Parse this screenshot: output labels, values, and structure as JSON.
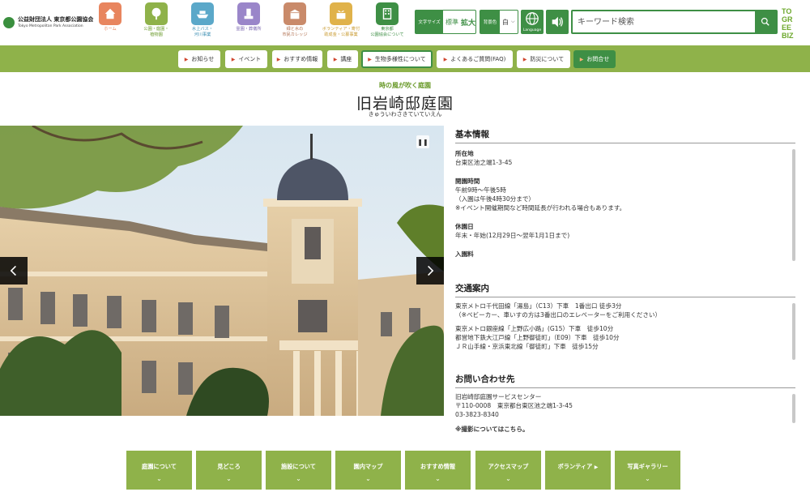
{
  "header": {
    "logo": {
      "line1": "公益財団法人 東京都公園協会",
      "line2": "Tokyo Metropolitan Park Association"
    },
    "nav_icons": [
      {
        "label": "ホーム",
        "color": "#e8855e",
        "icon": "home-icon"
      },
      {
        "label": "公園・庭園・\n植物園",
        "color": "#8fb24a",
        "icon": "tree-icon"
      },
      {
        "label": "水上バス・\n河川事業",
        "color": "#5ba8c9",
        "icon": "boat-icon"
      },
      {
        "label": "霊園・葬儀所",
        "color": "#9a86c9",
        "icon": "memorial-icon"
      },
      {
        "label": "緑と水の\n市民カレッジ",
        "color": "#c98a6a",
        "icon": "college-icon"
      },
      {
        "label": "ボランティア・寄付\n助成金・公募事業",
        "color": "#e0b24a",
        "icon": "volunteer-icon"
      },
      {
        "label": "東京都\n公園協会について",
        "color": "#3e8f45",
        "icon": "building-icon"
      }
    ],
    "font_size": {
      "title": "文字サイズ",
      "standard": "標準",
      "large": "拡大"
    },
    "bg_color": {
      "title": "背景色",
      "value": "白"
    },
    "language_label": "Language",
    "search": {
      "placeholder": "キーワード検索"
    },
    "brand": "TOKYO GREEN BIZ"
  },
  "gnav": {
    "items": [
      "お知らせ",
      "イベント",
      "おすすめ情報",
      "講座",
      "生物多様性について",
      "よくあるご質問(FAQ)",
      "防災について",
      "お問合せ"
    ]
  },
  "page": {
    "subtitle": "時の風が吹く庭園",
    "title": "旧岩崎邸庭園",
    "kana": "きゅういわさきていていえん"
  },
  "info": {
    "basic": {
      "heading": "基本情報",
      "address_label": "所在地",
      "address": "台東区池之端1-3-45",
      "hours_label": "開園時間",
      "hours": [
        "午前9時～午後5時",
        "（入園は午後4時30分まで）",
        "※イベント開催期間など時間延長が行われる場合もあります。"
      ],
      "closed_label": "休園日",
      "closed": "年末・年始(12月29日～翌年1月1日まで)",
      "fee_label": "入園料"
    },
    "access": {
      "heading": "交通案内",
      "lines": [
        "東京メトロ千代田線「湯島」（C13）下車　1番出口 徒歩3分",
        "（※ベビーカー、車いすの方は3番出口のエレベーターをご利用ください）",
        "",
        "東京メトロ銀座線「上野広小路」(G15）下車　徒歩10分",
        "都営地下鉄大江戸線「上野御徒町」（E09）下車　徒歩10分",
        "ＪＲ山手線・京浜東北線「御徒町」下車　徒歩15分"
      ]
    },
    "contact": {
      "heading": "お問い合わせ先",
      "lines": [
        "旧岩崎邸庭園サービスセンター",
        "〒110-0008　東京都台東区池之端1-3-45",
        "03-3823-8340"
      ],
      "photo_note": "※撮影についてはこちら。"
    }
  },
  "footer_nav": {
    "items": [
      "庭園について",
      "見どころ",
      "施設について",
      "園内マップ",
      "おすすめ情報",
      "アクセスマップ",
      "ボランティア",
      "写真ギャラリー"
    ],
    "chevron": "⌄"
  }
}
